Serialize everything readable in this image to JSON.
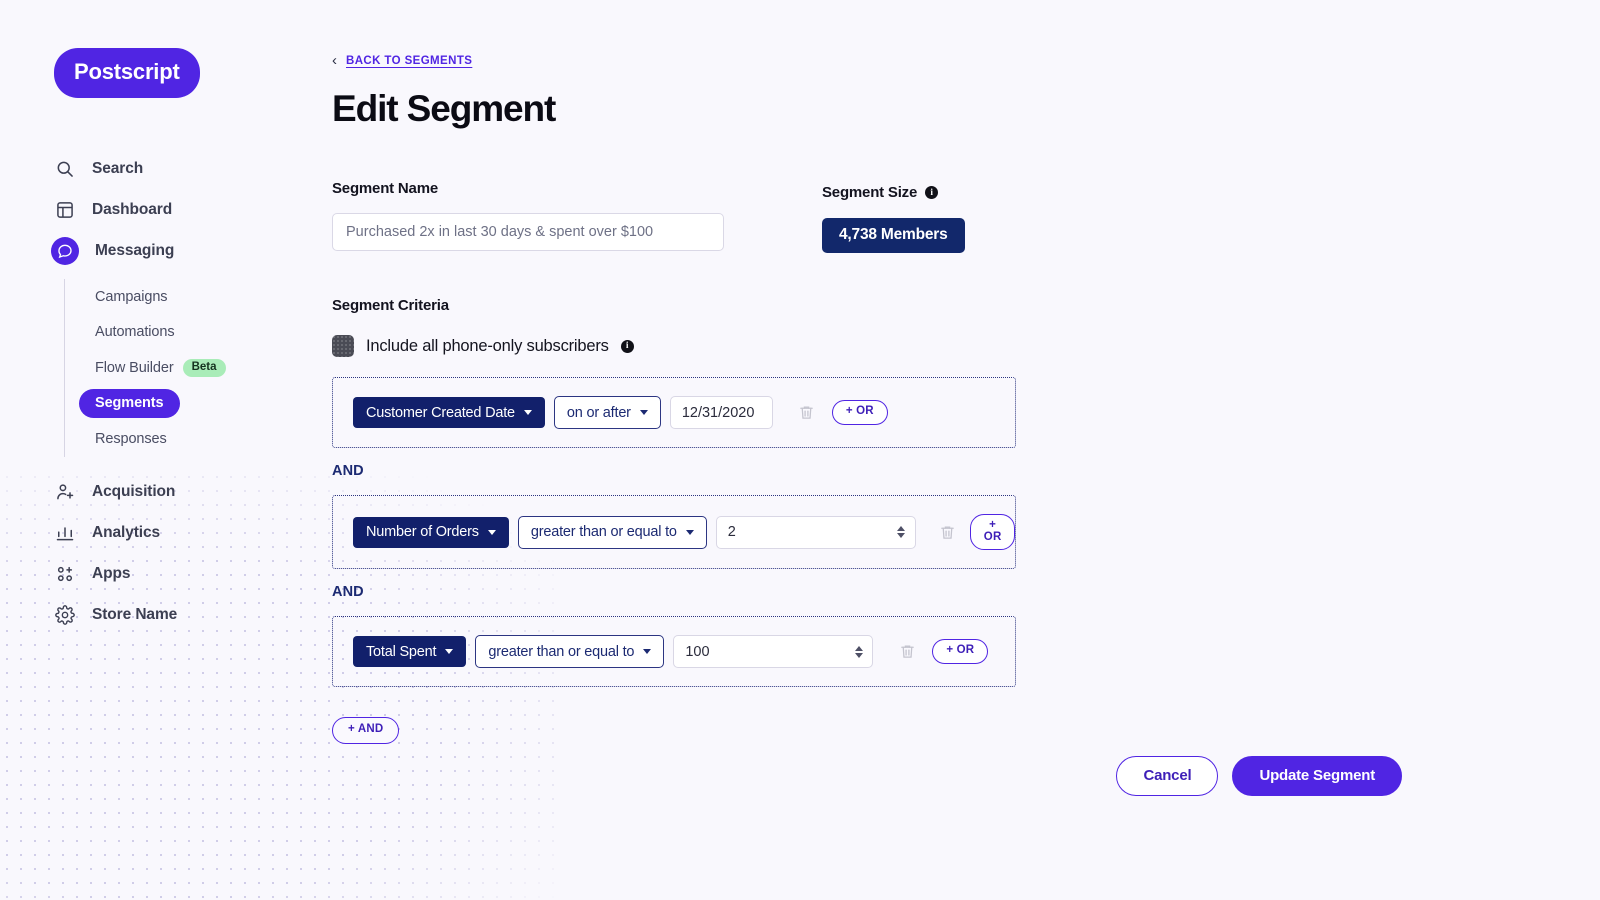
{
  "brand": {
    "logo_text": "Postscript",
    "purple": "#5025e3",
    "navy": "#12206b",
    "badge_navy": "#12286b",
    "beta_green": "#a9ecb8",
    "page_bg": "#f9f8fd"
  },
  "sidebar": {
    "items": [
      {
        "label": "Search",
        "icon": "search-icon"
      },
      {
        "label": "Dashboard",
        "icon": "dashboard-icon"
      },
      {
        "label": "Messaging",
        "icon": "messaging-icon",
        "active": true
      },
      {
        "label": "Acquisition",
        "icon": "acquisition-icon"
      },
      {
        "label": "Analytics",
        "icon": "analytics-icon"
      },
      {
        "label": "Apps",
        "icon": "apps-icon"
      },
      {
        "label": "Store Name",
        "icon": "gear-icon"
      }
    ],
    "subitems": [
      {
        "label": "Campaigns"
      },
      {
        "label": "Automations"
      },
      {
        "label": "Flow Builder",
        "badge": "Beta"
      },
      {
        "label": "Segments",
        "selected": true
      },
      {
        "label": "Responses"
      }
    ]
  },
  "header": {
    "back_link": "BACK TO SEGMENTS",
    "back_chevron": "‹",
    "title": "Edit Segment"
  },
  "segment_name": {
    "label": "Segment Name",
    "value": "",
    "placeholder": "Purchased 2x in last 30 days & spent over $100"
  },
  "segment_size": {
    "label": "Segment Size",
    "info_icon": "info-icon",
    "badge": "4,738 Members"
  },
  "criteria": {
    "title": "Segment Criteria",
    "phone_only_label": "Include all phone-only subscribers",
    "phone_only_checked": true,
    "and_label": "AND",
    "or_button": "+ OR",
    "and_button": "+ AND",
    "rows": [
      {
        "field": "Customer Created Date",
        "operator": "on or after",
        "value": "12/31/2020",
        "input_type": "date"
      },
      {
        "field": "Number of Orders",
        "operator": "greater than or equal to",
        "value": "2",
        "input_type": "number"
      },
      {
        "field": "Total Spent",
        "operator": "greater than or equal to",
        "value": "100",
        "input_type": "number"
      }
    ]
  },
  "footer": {
    "cancel_label": "Cancel",
    "primary_label": "Update Segment"
  }
}
